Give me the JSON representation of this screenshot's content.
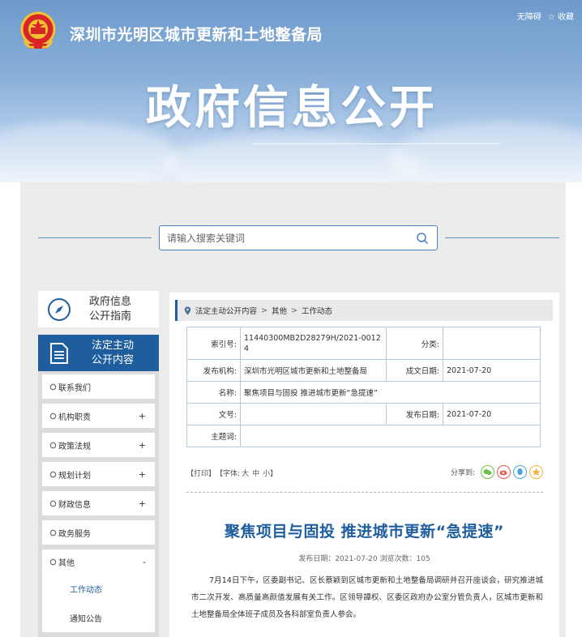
{
  "header": {
    "org_name": "深圳市光明区城市更新和土地整备局",
    "accessibility": "无障碍",
    "favorite": "☆ 收藏",
    "big_title": "政府信息公开"
  },
  "search": {
    "placeholder": "请输入搜索关键词"
  },
  "sidebar": {
    "guide_line1": "政府信息",
    "guide_line2": "公开指南",
    "active_line1": "法定主动",
    "active_line2": "公开内容",
    "items": [
      {
        "label": "联系我们",
        "toggle": ""
      },
      {
        "label": "机构职责",
        "toggle": "+"
      },
      {
        "label": "政策法规",
        "toggle": "+"
      },
      {
        "label": "规划计划",
        "toggle": "+"
      },
      {
        "label": "财政信息",
        "toggle": "+"
      },
      {
        "label": "政务服务",
        "toggle": ""
      },
      {
        "label": "其他",
        "toggle": "-"
      }
    ],
    "sub_items": [
      {
        "label": "工作动态"
      },
      {
        "label": "通知公告"
      }
    ]
  },
  "breadcrumb": {
    "items": [
      "法定主动公开内容",
      "其他",
      "工作动态"
    ],
    "sep": ">"
  },
  "info": {
    "index_label": "索引号:",
    "index_value_1": "11440300MB2D28279H/2021-0012",
    "index_value_2": "4",
    "category_label": "分类:",
    "category_value": "",
    "publisher_label": "发布机构:",
    "publisher_value": "深圳市光明区城市更新和土地整备局",
    "created_label": "成文日期:",
    "created_value": "2021-07-20",
    "name_label": "名称:",
    "name_value": "聚焦项目与固投 推进城市更新“急提速”",
    "docno_label": "文号:",
    "docno_value": "",
    "pubdate_label": "发布日期:",
    "pubdate_value": "2021-07-20",
    "subject_label": "主题词:",
    "subject_value": ""
  },
  "tools": {
    "print": "【打印】",
    "font_prefix": "【字体:",
    "font_large": "大",
    "font_medium": "中",
    "font_small": "小",
    "font_suffix": "】",
    "share_label": "分享到:"
  },
  "article": {
    "title": "聚焦项目与固投 推进城市更新“急提速”",
    "meta": "发布日期：2021-07-20  浏览次数：105",
    "body": "7月14日下午，区委副书记、区长蔡颖到区城市更新和土地整备局调研并召开座谈会，研究推进城市二次开发、高质量高颜值发展有关工作。区领导譚权、区委区政府办公室分管负责人，区城市更新和土地整备局全体班子成员及各科部室负责人参会。"
  },
  "colors": {
    "primary": "#1f5e9e",
    "banner": "#7fa6d3",
    "wechat": "#6cc04a",
    "weibo": "#e8584f",
    "qq": "#4aa3df",
    "qzone": "#f4b43b"
  }
}
